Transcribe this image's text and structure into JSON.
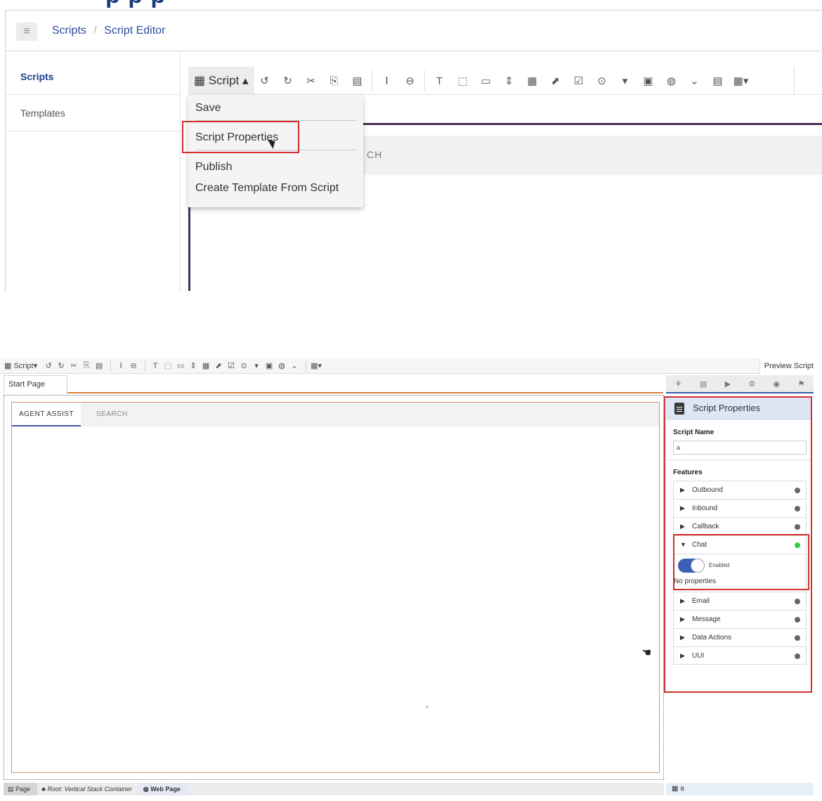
{
  "top": {
    "heading_fragment": "p  p                p",
    "breadcrumb": {
      "link1": "Scripts",
      "sep": "/",
      "link2": "Script Editor"
    },
    "hamburger_glyph": "≡",
    "sidebar": [
      {
        "label": "Scripts"
      },
      {
        "label": "Templates"
      }
    ],
    "toolbar": {
      "script_button": "Script",
      "icons": [
        "undo-icon",
        "redo-icon",
        "cut-icon",
        "copy-icon",
        "paste-icon",
        "input-icon",
        "separator-icon",
        "text-icon",
        "button-icon",
        "textbox-icon",
        "stepper-icon",
        "calendar-icon",
        "link-icon",
        "checkbox-icon",
        "radio-icon",
        "dropdown-icon",
        "image-icon",
        "web-icon",
        "chevron-circle-icon",
        "list-icon",
        "layout-icon"
      ],
      "glyphs": [
        "↺",
        "↻",
        "✂",
        "⎘",
        "▤",
        "Ⅰ",
        "⊖",
        "T",
        "⬚",
        "▭",
        "⇕",
        "▦",
        "⬈",
        "☑",
        "⊙",
        "▾",
        "▣",
        "◍",
        "⌄",
        "▤",
        "▦▾"
      ]
    },
    "dropdown": {
      "items": [
        "Save",
        "Script Properties",
        "Publish",
        "Create Template From Script"
      ]
    },
    "canvas_text_fragment": "CH"
  },
  "bottom": {
    "toolbar": {
      "script_button": "Script▾",
      "glyphs": [
        "↺",
        "↻",
        "✂",
        "⎘",
        "▤",
        "Ⅰ",
        "⊖",
        "T",
        "⬚",
        "▭",
        "⇕",
        "▦",
        "⬈",
        "☑",
        "⊙",
        "▾",
        "▣",
        "◍",
        "⌄",
        "▦▾"
      ],
      "preview_button": "Preview Script"
    },
    "page_tab": "Start Page",
    "inner_tabs": [
      "AGENT ASSIST",
      "SEARCH"
    ],
    "right_icons": [
      "⚘",
      "▤",
      "▶",
      "⚙",
      "◉",
      "⚑"
    ],
    "panel": {
      "title": "Script Properties",
      "script_name_label": "Script Name",
      "script_name_value": "a",
      "features_label": "Features",
      "features": [
        {
          "name": "Outbound",
          "expanded": false,
          "status": "gray"
        },
        {
          "name": "Inbound",
          "expanded": false,
          "status": "gray"
        },
        {
          "name": "Callback",
          "expanded": false,
          "status": "gray"
        },
        {
          "name": "Chat",
          "expanded": true,
          "status": "green"
        },
        {
          "name": "Email",
          "expanded": false,
          "status": "gray"
        },
        {
          "name": "Message",
          "expanded": false,
          "status": "gray"
        },
        {
          "name": "Data Actions",
          "expanded": false,
          "status": "gray"
        },
        {
          "name": "UUI",
          "expanded": false,
          "status": "gray"
        }
      ],
      "chat_toggle_label": "Enabled",
      "chat_no_properties": "No properties"
    },
    "statusbar": {
      "crumbs": [
        "Page",
        "Root: Vertical Stack Container",
        "Web Page"
      ],
      "right_value": "a"
    },
    "colors": {
      "accent_blue": "#3a5aa8",
      "highlight_red": "#d32f2f",
      "status_green": "#33cc44"
    }
  }
}
